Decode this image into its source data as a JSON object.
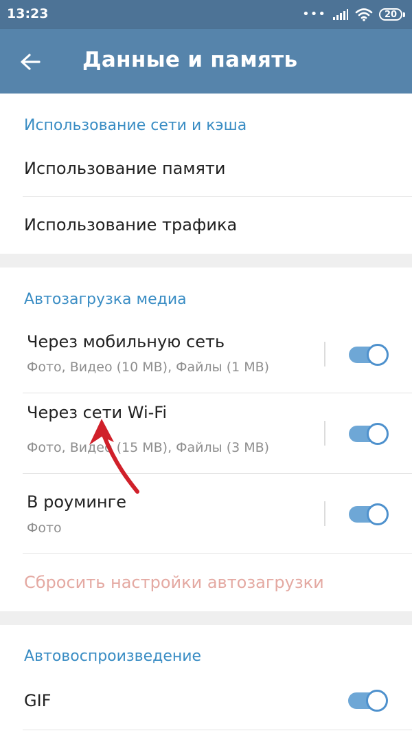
{
  "status_bar": {
    "time": "13:23",
    "dots": "•••",
    "battery": "20"
  },
  "app_bar": {
    "title": "Данные и память"
  },
  "sections": {
    "network": {
      "header": "Использование сети и кэша",
      "items": [
        {
          "label": "Использование памяти"
        },
        {
          "label": "Использование трафика"
        }
      ]
    },
    "autodownload": {
      "header": "Автозагрузка медиа",
      "items": [
        {
          "title": "Через мобильную сеть",
          "subtitle": "Фото, Видео (10 MB), Файлы (1 MB)",
          "enabled": true
        },
        {
          "title": "Через сети Wi-Fi",
          "subtitle": "Фото, Видео (15 MB), Файлы (3 MB)",
          "enabled": true
        },
        {
          "title": "В роуминге",
          "subtitle": "Фото",
          "enabled": true
        }
      ],
      "reset_label": "Сбросить настройки автозагрузки"
    },
    "autoplay": {
      "header": "Автовоспроизведение",
      "items": [
        {
          "label": "GIF",
          "enabled": true
        }
      ]
    }
  },
  "colors": {
    "status_bar": "#4d7396",
    "app_bar": "#5684ab",
    "section_header": "#3a8dc4",
    "switch_on": "#6ea7d6",
    "reset_text": "#e4a9a2",
    "annotation_arrow": "#d0202a"
  },
  "icons": {
    "back": "arrow-left-icon",
    "wifi": "wifi-icon",
    "signal": "signal-icon",
    "battery": "battery-icon"
  }
}
